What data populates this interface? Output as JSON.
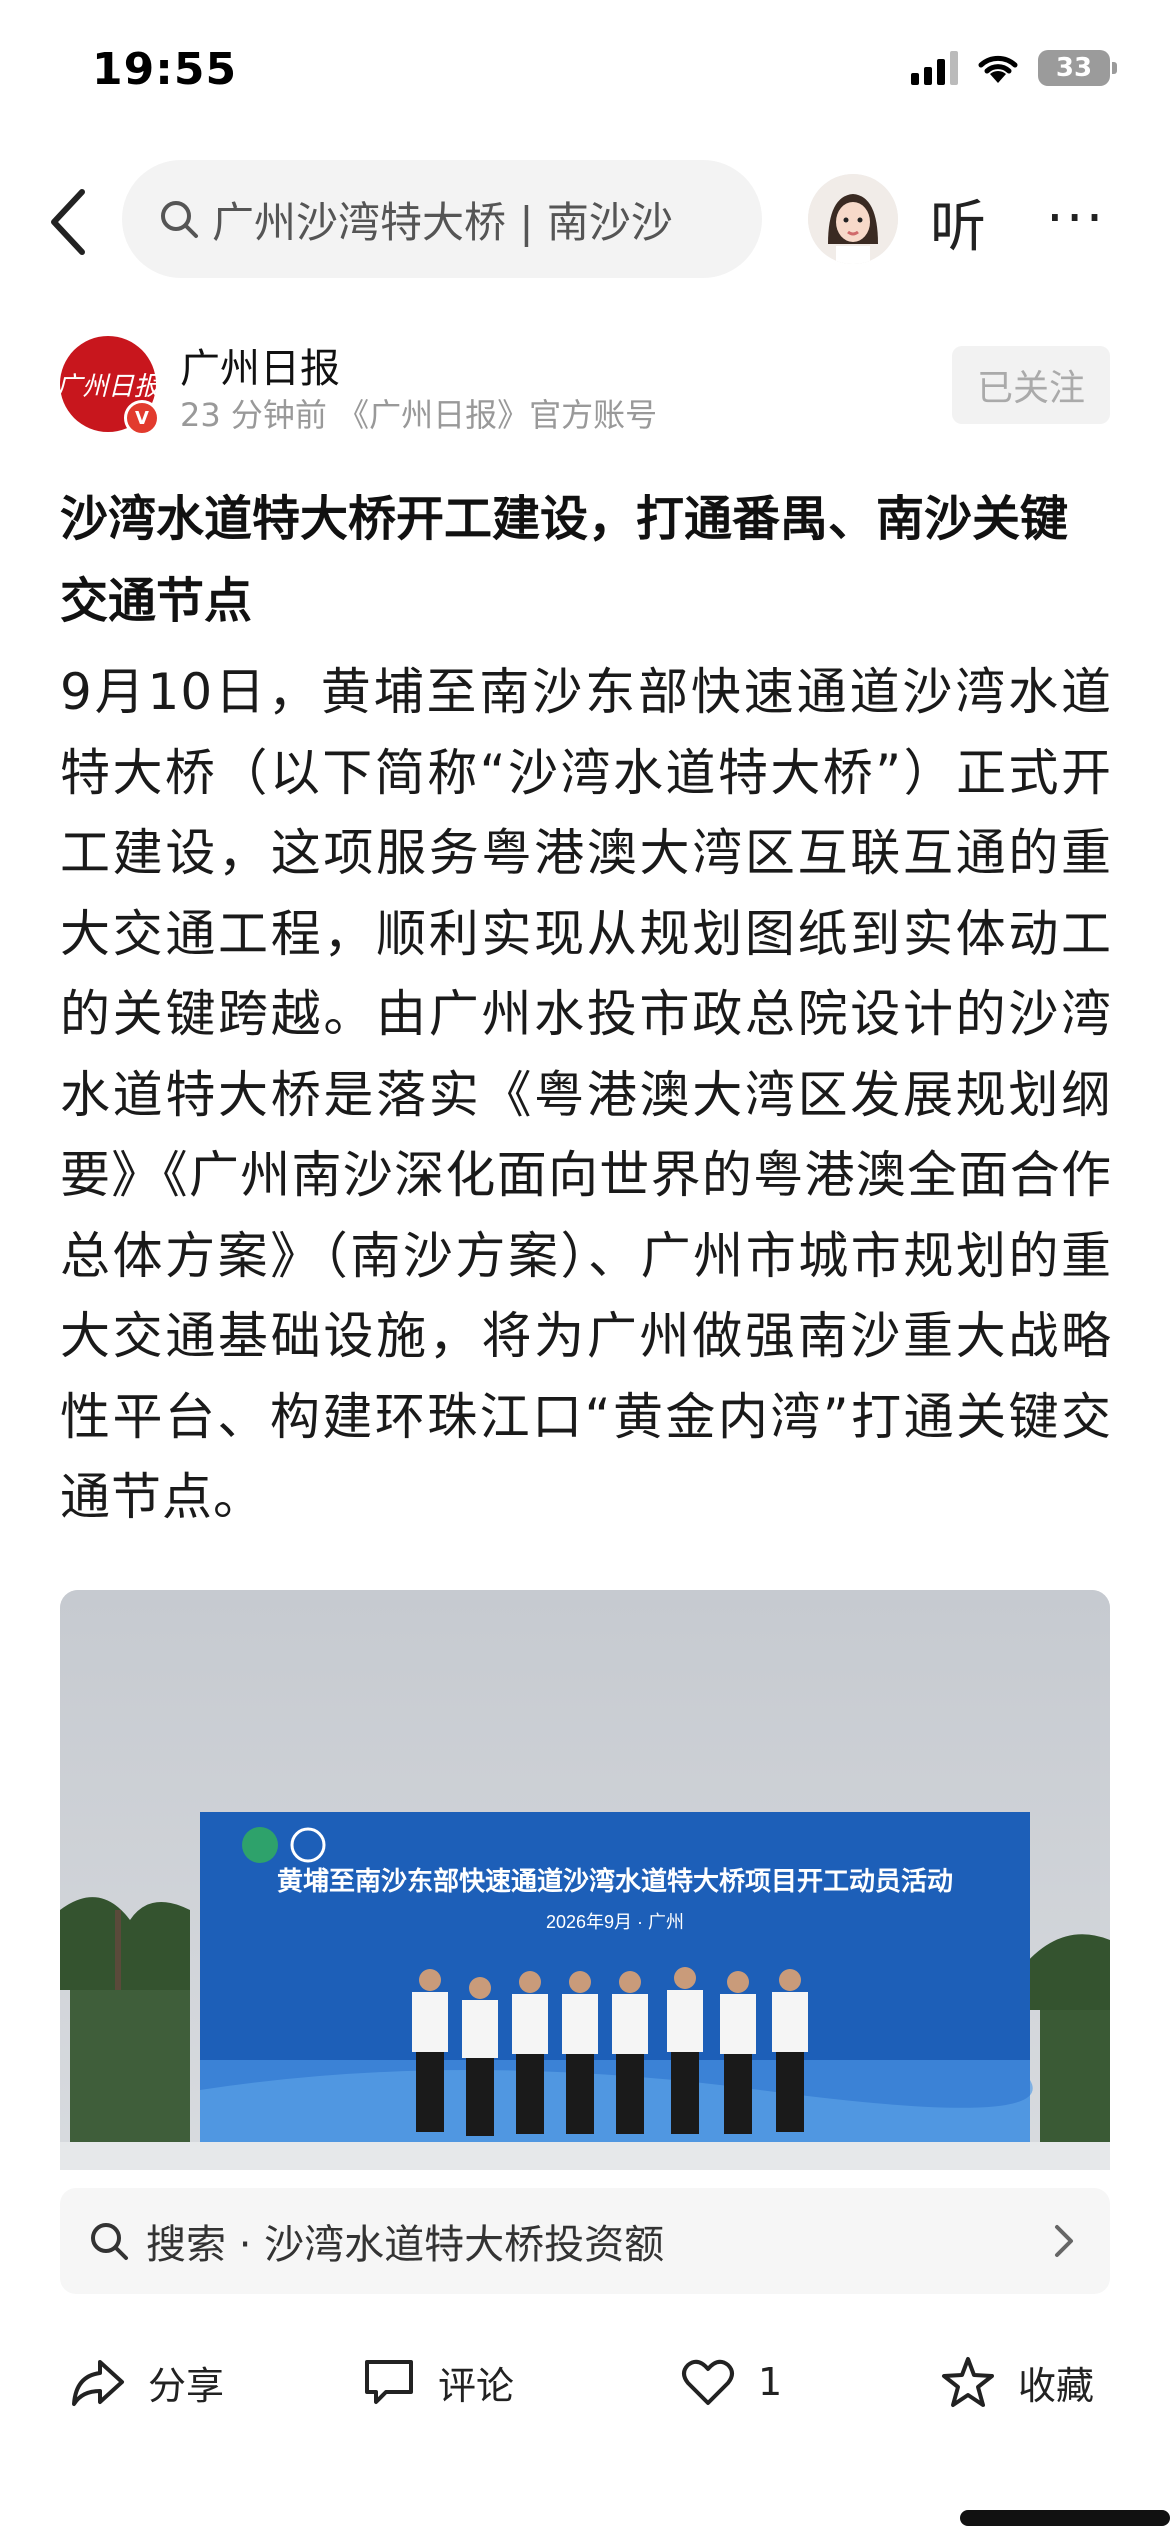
{
  "status_bar": {
    "time": "19:55",
    "battery": "33"
  },
  "nav": {
    "search_text": "广州沙湾特大桥 | 南沙沙",
    "listen_label": "听",
    "more_label": "···"
  },
  "author": {
    "logo_text": "广州日报",
    "verify_mark": "V",
    "name": "广州日报",
    "meta": "23 分钟前 《广州日报》官方账号",
    "follow_label": "已关注"
  },
  "article": {
    "headline": "沙湾水道特大桥开工建设，打通番禺、南沙关键交通节点",
    "body": "9月10日，黄埔至南沙东部快速通道沙湾水道特大桥（以下简称“沙湾水道特大桥”）正式开工建设，这项服务粤港澳大湾区互联互通的重大交通工程，顺利实现从规划图纸到实体动工的关键跨越。由广州水投市政总院设计的沙湾水道特大桥是落实《粤港澳大湾区发展规划纲要》《广州南沙深化面向世界的粤港澳全面合作总体方案》（南沙方案）、广州市城市规划的重大交通基础设施，将为广州做强南沙重大战略性平台、构建环珠江口“黄金内湾”打通关键交通节点。"
  },
  "photo": {
    "banner_title": "黄埔至南沙东部快速通道沙湾水道特大桥项目开工动员活动",
    "banner_date": "2026年9月 · 广州"
  },
  "suggest": {
    "label": "搜索 · 沙湾水道特大桥投资额"
  },
  "actions": {
    "share_label": "分享",
    "comment_label": "评论",
    "like_count": "1",
    "collect_label": "收藏"
  },
  "colors": {
    "brand_red": "#c8161d",
    "banner_blue": "#1d5fb8",
    "text": "#1a1a1a",
    "muted": "#999999"
  }
}
